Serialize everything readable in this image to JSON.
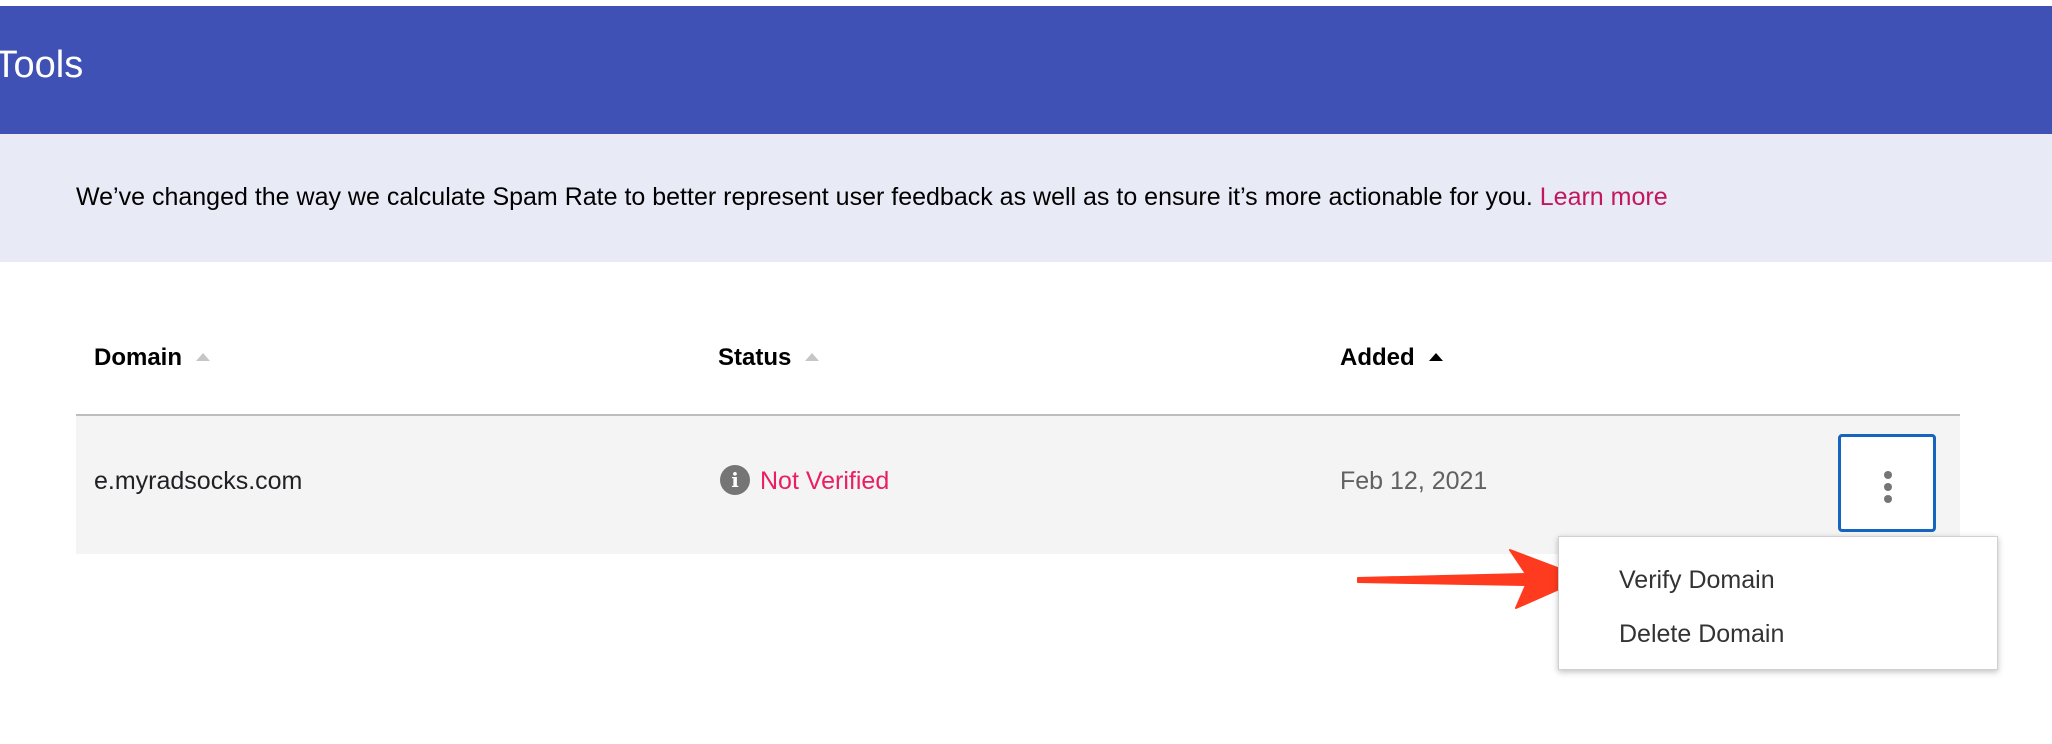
{
  "header": {
    "title": "r Tools"
  },
  "banner": {
    "text": "We’ve changed the way we calculate Spam Rate to better represent user feedback as well as to ensure it’s more actionable for you. ",
    "link": "Learn more"
  },
  "table": {
    "columns": {
      "domain": "Domain",
      "status": "Status",
      "added": "Added"
    },
    "rows": [
      {
        "domain": "e.myradsocks.com",
        "status": "Not Verified",
        "added": "Feb 12, 2021"
      }
    ]
  },
  "menu": {
    "items": [
      {
        "label": "Verify Domain"
      },
      {
        "label": "Delete Domain"
      }
    ]
  },
  "colors": {
    "header_bg": "#3f51b5",
    "banner_bg": "#e8eaf6",
    "link": "#c2185b",
    "status_not_verified": "#e91e63",
    "focus_border": "#1565c0",
    "annotation_arrow": "#ff3b1f"
  },
  "icons": {
    "status": "info-icon",
    "row_actions": "more-vert-icon",
    "annotation": "red-arrow-annotation"
  }
}
